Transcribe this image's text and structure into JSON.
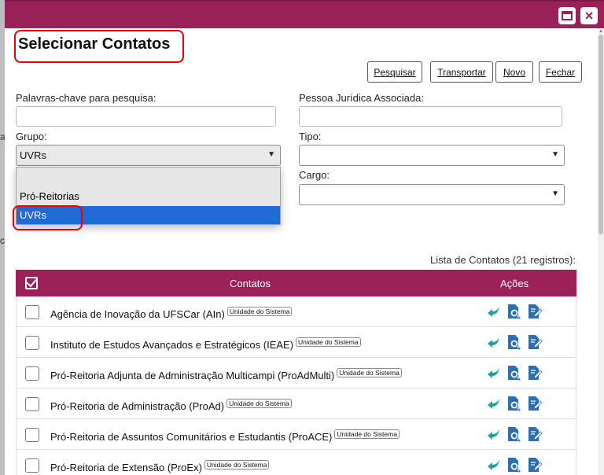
{
  "window": {
    "maximize_icon": "maximize-icon",
    "close_label": "×"
  },
  "background": {
    "fragments": [
      "a",
      "ca"
    ]
  },
  "page": {
    "title": "Selecionar Contatos"
  },
  "toolbar": {
    "search_label": "Pesquisar",
    "transport_label": "Transportar",
    "new_label": "Novo",
    "close_label": "Fechar"
  },
  "form": {
    "keywords_label": "Palavras-chave para pesquisa:",
    "keywords_value": "",
    "legal_entity_label": "Pessoa Jurídica Associada:",
    "legal_entity_value": "",
    "group_label": "Grupo:",
    "group_value": "UVRs",
    "type_label": "Tipo:",
    "type_value": "",
    "role_label": "Cargo:",
    "role_value": ""
  },
  "group_dropdown": {
    "options": [
      "",
      "Pró-Reitorias",
      "UVRs"
    ],
    "selected": "UVRs"
  },
  "list": {
    "count_text": "Lista de Contatos (21 registros):",
    "header_contacts": "Contatos",
    "header_actions": "Ações",
    "rows": [
      {
        "name": "Agência de Inovação da UFSCar (AIn)",
        "badge": "Unidade do Sistema"
      },
      {
        "name": "Instituto de Estudos Avançados e Estratégicos (IEAE)",
        "badge": "Unidade do Sistema"
      },
      {
        "name": "Pró-Reitoria Adjunta de Administração Multicampi (ProAdMulti)",
        "badge": "Unidade do Sistema"
      },
      {
        "name": "Pró-Reitoria de Administração (ProAd)",
        "badge": "Unidade do Sistema"
      },
      {
        "name": "Pró-Reitoria de Assuntos Comunitários e Estudantis (ProACE)",
        "badge": "Unidade do Sistema"
      },
      {
        "name": "Pró-Reitoria de Extensão (ProEx)",
        "badge": "Unidade do Sistema"
      }
    ]
  },
  "colors": {
    "brand": "#9b2159",
    "action_teal": "#1ba39c",
    "action_blue": "#2f6fb0",
    "highlight_red": "#e00000",
    "selection_blue": "#2169d5"
  }
}
